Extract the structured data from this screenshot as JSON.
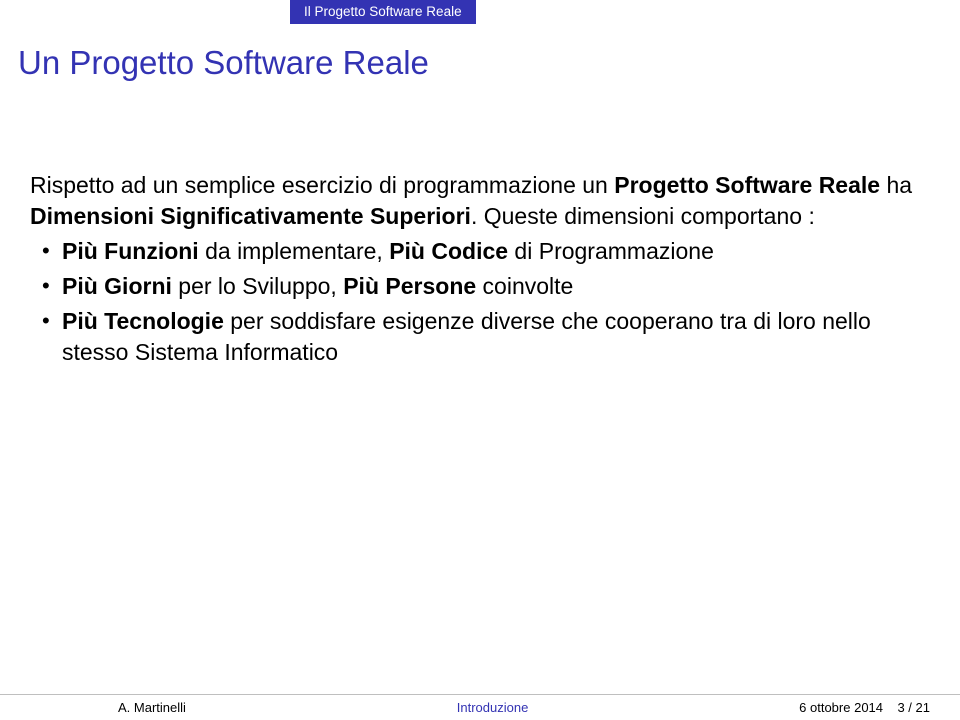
{
  "header_tab": "Il Progetto Software Reale",
  "title": "Un Progetto Software Reale",
  "intro_part1": "Rispetto ad un semplice esercizio di programmazione un ",
  "intro_bold1": "Progetto Software Reale",
  "intro_part2": " ha ",
  "intro_bold2": "Dimensioni Significativamente Superiori",
  "intro_part3": ". Queste dimensioni comportano :",
  "bullets": [
    {
      "b1": "Più Funzioni",
      "t1": " da implementare, ",
      "b2": "Più Codice",
      "t2": " di Programmazione"
    },
    {
      "b1": "Più Giorni",
      "t1": " per lo Sviluppo, ",
      "b2": "Più Persone",
      "t2": " coinvolte"
    },
    {
      "b1": "Più Tecnologie",
      "t1": " per soddisfare esigenze diverse che cooperano tra di loro nello stesso Sistema Informatico",
      "b2": "",
      "t2": ""
    }
  ],
  "footer": {
    "author": "A. Martinelli",
    "center": "Introduzione",
    "date": "6 ottobre 2014",
    "page": "3 / 21"
  }
}
